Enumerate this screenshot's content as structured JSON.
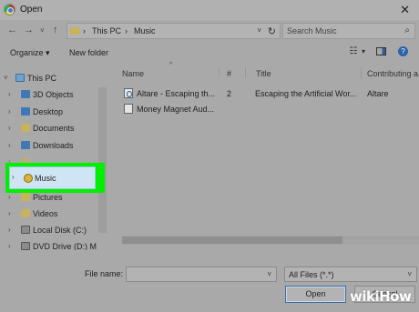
{
  "window": {
    "title": "Open",
    "close_glyph": "✕"
  },
  "address": {
    "back": "←",
    "forward": "→",
    "recent": "˅",
    "up": "↑",
    "crumbs": [
      "This PC",
      "›",
      "Music"
    ],
    "separator_first": "›",
    "dropdown": "˅",
    "refresh": "↻"
  },
  "search": {
    "placeholder": "Search Music",
    "icon": "search-icon"
  },
  "toolbar": {
    "organize": "Organize ▾",
    "new_folder": "New folder",
    "view_glyph": "☷",
    "view_caret": "▾",
    "help": "?"
  },
  "navpane": {
    "items": [
      {
        "label": "This PC",
        "icon": "computer-icon"
      },
      {
        "label": "3D Objects",
        "icon": "folder-icon"
      },
      {
        "label": "Desktop",
        "icon": "folder-icon"
      },
      {
        "label": "Documents",
        "icon": "folder-icon"
      },
      {
        "label": "Downloads",
        "icon": "folder-icon"
      },
      {
        "label": "Music",
        "icon": "music-icon"
      },
      {
        "label": "Pictures",
        "icon": "folder-icon"
      },
      {
        "label": "Videos",
        "icon": "folder-icon"
      },
      {
        "label": "Local Disk (C:)",
        "icon": "drive-icon"
      },
      {
        "label": "DVD Drive (D:) M",
        "icon": "drive-icon"
      }
    ],
    "chevron": "›",
    "expanded_chevron": "˅",
    "highlight_color": "#00f000"
  },
  "columns": {
    "name": "Name",
    "number": "#",
    "title": "Title",
    "artist": "Contributing a",
    "sort_glyph": "^"
  },
  "files": [
    {
      "name": "Altare - Escaping th...",
      "number": "2",
      "title": "Escaping the Artificial Wor...",
      "artist": "Altare"
    },
    {
      "name": "Money Magnet Aud...",
      "number": "",
      "title": "",
      "artist": ""
    }
  ],
  "bottom": {
    "filename_label": "File name:",
    "filename_value": "",
    "filetype_value": "All Files (*.*)",
    "caret": "˅",
    "open": "Open",
    "cancel": "Cancel"
  },
  "watermark": {
    "wiki": "wiki",
    "how": "How"
  },
  "colors": {
    "window_bg": "#a9a9a9",
    "selection": "#cfe5f3",
    "folder": "#c7b25d"
  }
}
